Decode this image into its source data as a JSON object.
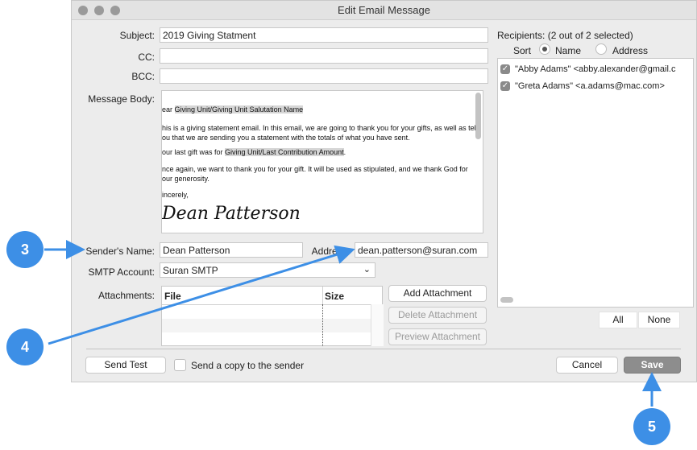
{
  "window": {
    "title": "Edit Email Message"
  },
  "form": {
    "subject_label": "Subject:",
    "subject_value": "2019 Giving Statment",
    "cc_label": "CC:",
    "cc_value": "",
    "bcc_label": "BCC:",
    "bcc_value": "",
    "message_label": "Message Body:",
    "message": {
      "greeting_prefix": "ear ",
      "greeting_field": "Giving Unit/Giving Unit Salutation Name",
      "line1": "his is a giving statement email. In this email, we are going to thank you for your gifts, as well as tell",
      "line2": "ou that we are sending you a statement with the totals of what you have sent.",
      "line3_prefix": "our last gift was for ",
      "line3_field": "Giving Unit/Last Contribution Amount",
      "line3_suffix": ".",
      "line4": "nce again, we want to thank you for your gift. It will be used as stipulated, and we thank God for",
      "line5": "our generosity.",
      "closing": "incerely,",
      "signature": "Dean Patterson"
    },
    "sender_label": "Sender's Name:",
    "sender_value": "Dean Patterson",
    "address_label": "Address:",
    "address_value": "dean.patterson@suran.com",
    "smtp_label": "SMTP Account:",
    "smtp_value": "Suran SMTP",
    "attachments_label": "Attachments:",
    "attach_col_file": "File",
    "attach_col_size": "Size",
    "add_attachment": "Add Attachment",
    "delete_attachment": "Delete Attachment",
    "preview_attachment": "Preview Attachment"
  },
  "recipients": {
    "header": "Recipients: (2 out of 2 selected)",
    "sort_label": "Sort",
    "sort_name": "Name",
    "sort_address": "Address",
    "sort_selected": "Name",
    "items": [
      {
        "text": "\"Abby Adams\" <abby.alexander@gmail.c",
        "checked": true
      },
      {
        "text": "\"Greta Adams\" <a.adams@mac.com>",
        "checked": true
      }
    ],
    "all_button": "All",
    "none_button": "None"
  },
  "footer": {
    "send_test": "Send Test",
    "send_copy_label": "Send a copy to the sender",
    "send_copy_checked": false,
    "cancel": "Cancel",
    "save": "Save"
  },
  "callouts": {
    "c3": "3",
    "c4": "4",
    "c5": "5"
  },
  "colors": {
    "callout": "#3d8fe6",
    "window_bg": "#ececec"
  }
}
